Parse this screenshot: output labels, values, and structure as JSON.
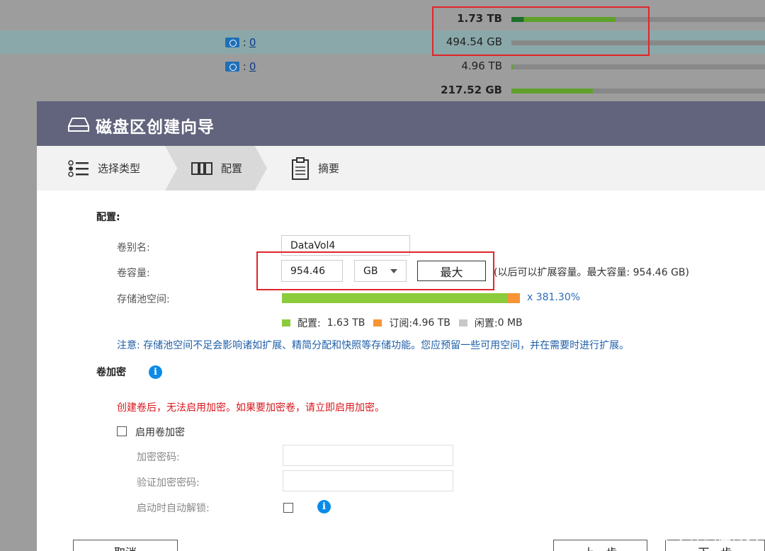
{
  "background_list": {
    "rows": [
      {
        "snapshots": "",
        "capacity": "1.73 TB",
        "bold": true,
        "used_fraction": 0.41,
        "dark_fraction": 0.05
      },
      {
        "snapshots": "0",
        "capacity": "494.54 GB",
        "bold": false,
        "used_fraction": 0.0,
        "dark_fraction": 0.0
      },
      {
        "snapshots": "0",
        "capacity": "4.96 TB",
        "bold": false,
        "used_fraction": 0.005,
        "dark_fraction": 0.0
      },
      {
        "snapshots": "",
        "capacity": "217.52 GB",
        "bold": true,
        "used_fraction": 0.32,
        "dark_fraction": 0.0
      }
    ],
    "snapshot_prefix": ":"
  },
  "dialog": {
    "title": "磁盘区创建向导",
    "icon": "hdd-icon",
    "steps": [
      {
        "label": "选择类型",
        "icon": "list-icon"
      },
      {
        "label": "配置",
        "icon": "config-icon",
        "active": true
      },
      {
        "label": "摘要",
        "icon": "clipboard-icon"
      }
    ]
  },
  "config": {
    "section_title": "配置:",
    "alias_label": "卷别名:",
    "alias_value": "DataVol4",
    "capacity_label": "卷容量:",
    "capacity_value": "954.46",
    "unit_value": "GB",
    "max_button": "最大",
    "capacity_hint": "(以后可以扩展容量。最大容量: 954.46 GB)",
    "pool_label": "存储池空间:",
    "pool_allocated_fraction": 0.95,
    "pool_percent": "x 381.30%",
    "legend": [
      {
        "label": "配置:",
        "value": "1.63 TB",
        "color": "#8ccb3c"
      },
      {
        "label": "订阅:",
        "value": "4.96 TB",
        "color": "#f79433"
      },
      {
        "label": "闲置:",
        "value": "0 MB",
        "color": "#c8c8c8"
      }
    ],
    "note": "注意: 存储池空间不足会影响诸如扩展、精简分配和快照等存储功能。您应预留一些可用空间，并在需要时进行扩展。"
  },
  "encryption": {
    "section_title": "卷加密",
    "warning": "创建卷后，无法启用加密。如果要加密卷，请立即启用加密。",
    "enable_label": "启用卷加密",
    "password_label": "加密密码:",
    "verify_label": "验证加密密码:",
    "auto_unlock_label": "启动时自动解锁:"
  },
  "footer": {
    "cancel": "取消",
    "prev": "上一步",
    "next": "下一步"
  },
  "watermark": "什么值得买"
}
